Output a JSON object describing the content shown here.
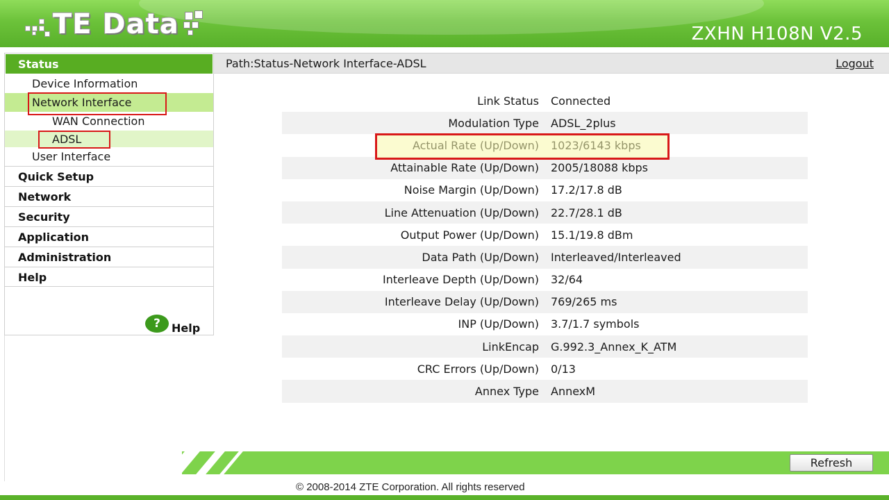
{
  "header": {
    "logo_text": "TE Data",
    "model": "ZXHN H108N V2.5"
  },
  "sidebar": {
    "status_label": "Status",
    "status_items": [
      {
        "label": "Device Information"
      },
      {
        "label": "Network Interface"
      },
      {
        "label": "WAN Connection"
      },
      {
        "label": "ADSL"
      },
      {
        "label": "User Interface"
      }
    ],
    "menu": [
      {
        "label": "Quick Setup"
      },
      {
        "label": "Network"
      },
      {
        "label": "Security"
      },
      {
        "label": "Application"
      },
      {
        "label": "Administration"
      },
      {
        "label": "Help"
      }
    ],
    "help_icon": "question-icon",
    "help_icon_glyph": "?",
    "help_label": "Help"
  },
  "pathbar": {
    "path": "Path:Status-Network Interface-ADSL",
    "logout": "Logout"
  },
  "adsl": {
    "rows": [
      {
        "label": "Link Status",
        "value": "Connected"
      },
      {
        "label": "Modulation Type",
        "value": "ADSL_2plus"
      },
      {
        "label": "Actual Rate (Up/Down)",
        "value": "1023/6143 kbps"
      },
      {
        "label": "Attainable Rate (Up/Down)",
        "value": "2005/18088 kbps"
      },
      {
        "label": "Noise Margin (Up/Down)",
        "value": "17.2/17.8 dB"
      },
      {
        "label": "Line Attenuation (Up/Down)",
        "value": "22.7/28.1 dB"
      },
      {
        "label": "Output Power (Up/Down)",
        "value": "15.1/19.8 dBm"
      },
      {
        "label": "Data Path (Up/Down)",
        "value": "Interleaved/Interleaved"
      },
      {
        "label": "Interleave Depth (Up/Down)",
        "value": "32/64"
      },
      {
        "label": "Interleave Delay (Up/Down)",
        "value": "769/265 ms"
      },
      {
        "label": "INP (Up/Down)",
        "value": "3.7/1.7 symbols"
      },
      {
        "label": "LinkEncap",
        "value": "G.992.3_Annex_K_ATM"
      },
      {
        "label": "CRC Errors (Up/Down)",
        "value": "0/13"
      },
      {
        "label": "Annex Type",
        "value": "AnnexM"
      }
    ]
  },
  "footer": {
    "refresh": "Refresh",
    "copyright": "© 2008-2014 ZTE Corporation. All rights reserved"
  },
  "colors": {
    "brand_green": "#58ad22",
    "highlight_green": "#c4eb92",
    "annotation_red": "#d81818"
  }
}
